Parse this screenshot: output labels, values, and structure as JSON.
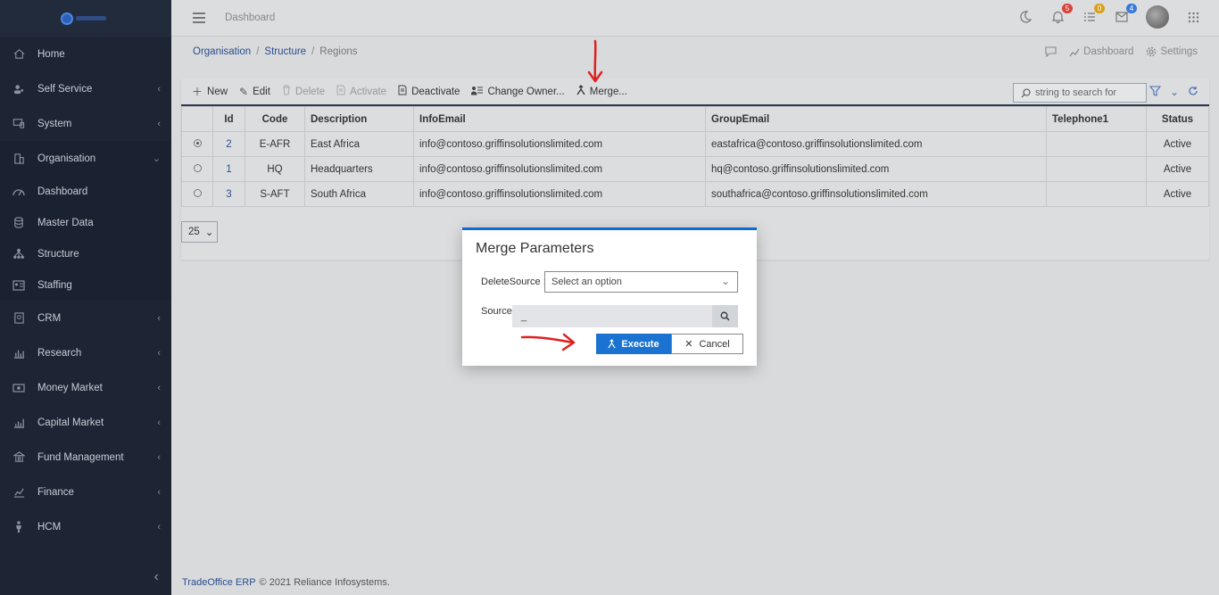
{
  "topbar": {
    "title": "Dashboard",
    "badges": {
      "notifications": "5",
      "tasks": "0",
      "messages": "4"
    }
  },
  "sidebar": {
    "items": [
      {
        "label": "Home",
        "icon": "home-icon"
      },
      {
        "label": "Self Service",
        "icon": "users-icon"
      },
      {
        "label": "System",
        "icon": "monitor-icon"
      },
      {
        "label": "Organisation",
        "icon": "building-icon"
      },
      {
        "label": "Dashboard",
        "icon": "gauge-icon"
      },
      {
        "label": "Master Data",
        "icon": "database-icon"
      },
      {
        "label": "Structure",
        "icon": "sitemap-icon"
      },
      {
        "label": "Staffing",
        "icon": "id-card-icon"
      },
      {
        "label": "CRM",
        "icon": "contacts-icon"
      },
      {
        "label": "Research",
        "icon": "bar-chart-icon"
      },
      {
        "label": "Money Market",
        "icon": "money-icon"
      },
      {
        "label": "Capital Market",
        "icon": "chart-icon"
      },
      {
        "label": "Fund Management",
        "icon": "bank-icon"
      },
      {
        "label": "Finance",
        "icon": "finance-icon"
      },
      {
        "label": "HCM",
        "icon": "person-icon"
      }
    ]
  },
  "breadcrumb": {
    "level1": "Organisation",
    "level2": "Structure",
    "level3": "Regions"
  },
  "header_links": {
    "chat": "",
    "dashboard": "Dashboard",
    "settings": "Settings"
  },
  "toolbar": {
    "new": "New",
    "edit": "Edit",
    "delete": "Delete",
    "activate": "Activate",
    "deactivate": "Deactivate",
    "change_owner": "Change Owner...",
    "merge": "Merge...",
    "search_placeholder": "string to search for"
  },
  "table": {
    "headers": [
      "Id",
      "Code",
      "Description",
      "InfoEmail",
      "GroupEmail",
      "Telephone1",
      "Status"
    ],
    "rows": [
      {
        "id": "2",
        "code": "E-AFR",
        "description": "East Africa",
        "info": "info@contoso.griffinsolutionslimited.com",
        "group": "eastafrica@contoso.griffinsolutionslimited.com",
        "tel": "",
        "status": "Active",
        "selected": true
      },
      {
        "id": "1",
        "code": "HQ",
        "description": "Headquarters",
        "info": "info@contoso.griffinsolutionslimited.com",
        "group": "hq@contoso.griffinsolutionslimited.com",
        "tel": "",
        "status": "Active",
        "selected": false
      },
      {
        "id": "3",
        "code": "S-AFT",
        "description": "South Africa",
        "info": "info@contoso.griffinsolutionslimited.com",
        "group": "southafrica@contoso.griffinsolutionslimited.com",
        "tel": "",
        "status": "Active",
        "selected": false
      }
    ],
    "page_size": "25"
  },
  "modal": {
    "title": "Merge Parameters",
    "delete_source_label": "DeleteSource :",
    "delete_source_value": "Select an option",
    "source_label": "Source",
    "source_value": "_",
    "execute": "Execute",
    "cancel": "Cancel"
  },
  "footer": {
    "brand": "TradeOffice ERP",
    "text": "© 2021 Reliance Infosystems."
  },
  "colors": {
    "sidebar": "#1d2534",
    "accent": "#1a73d1",
    "annotation": "#e02020"
  }
}
